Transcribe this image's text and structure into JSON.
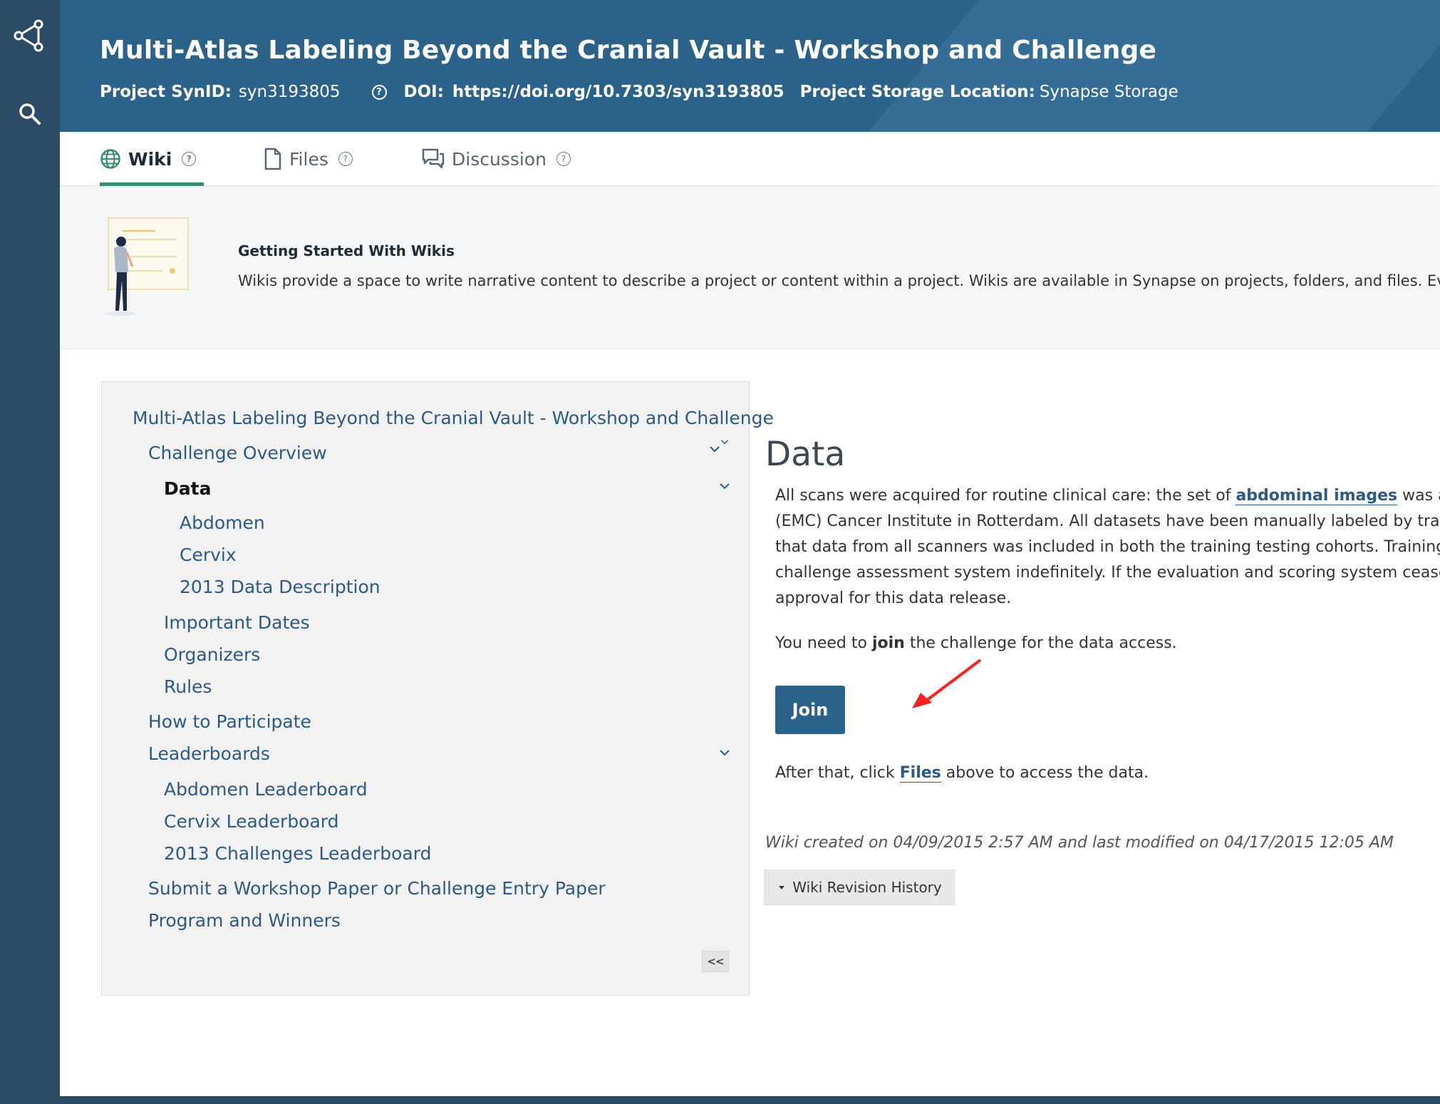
{
  "header": {
    "title": "Multi-Atlas Labeling Beyond the Cranial Vault - Workshop and Challenge",
    "synid_label": "Project SynID:",
    "synid_value": "syn3193805",
    "doi_label": "DOI:",
    "doi_value": "https://doi.org/10.7303/syn3193805",
    "storage_label": "Project Storage Location:",
    "storage_value": "Synapse Storage"
  },
  "tabs": {
    "wiki": "Wiki",
    "files": "Files",
    "discussion": "Discussion"
  },
  "getting_started": {
    "heading": "Getting Started With Wikis",
    "text": "Wikis provide a space to write narrative content to describe a project or content within a project. Wikis are available in Synapse on projects, folders, and files. Every project has a separate"
  },
  "toc": {
    "items": [
      "Multi-Atlas Labeling Beyond the Cranial Vault - Workshop and Challenge",
      "Challenge Overview",
      "Data",
      "Abdomen",
      "Cervix",
      "2013 Data Description",
      "Important Dates",
      "Organizers",
      "Rules",
      "How to Participate",
      "Leaderboards",
      "Abdomen Leaderboard",
      "Cervix Leaderboard",
      "2013 Challenges Leaderboard",
      "Submit a Workshop Paper or Challenge Entry Paper",
      "Program and Winners"
    ],
    "collapse_label": "<<"
  },
  "content": {
    "heading": "Data",
    "para_lines": [
      "All scans were acquired for routine clinical care: the set of ",
      "abdominal images",
      " was acquire",
      "(EMC) Cancer Institute in Rotterdam. All datasets have been manually labeled by trained r",
      "that data from all scanners was included in both the training testing cohorts. Training data",
      "challenge assessment system indefinitely. If the evaluation and scoring system ceases to fu",
      "approval for this data release."
    ],
    "need_pre": "You need to ",
    "need_bold": "join",
    "need_post": " the challenge for the data access.",
    "join_button": "Join",
    "after_pre": "After that, click ",
    "after_link": "Files",
    "after_post": " above to access the data.",
    "created": "Wiki created on  04/09/2015 2:57 AM  and last modified on  04/17/2015 12:05 AM",
    "revision_button": "Wiki Revision History"
  },
  "colors": {
    "header_bg": "#2a6289",
    "left_nav_bg": "#2c4a63",
    "link": "#2c5a85",
    "wiki_tab_underline": "#3d8a74",
    "annotation_arrow": "#ff1f1f"
  }
}
